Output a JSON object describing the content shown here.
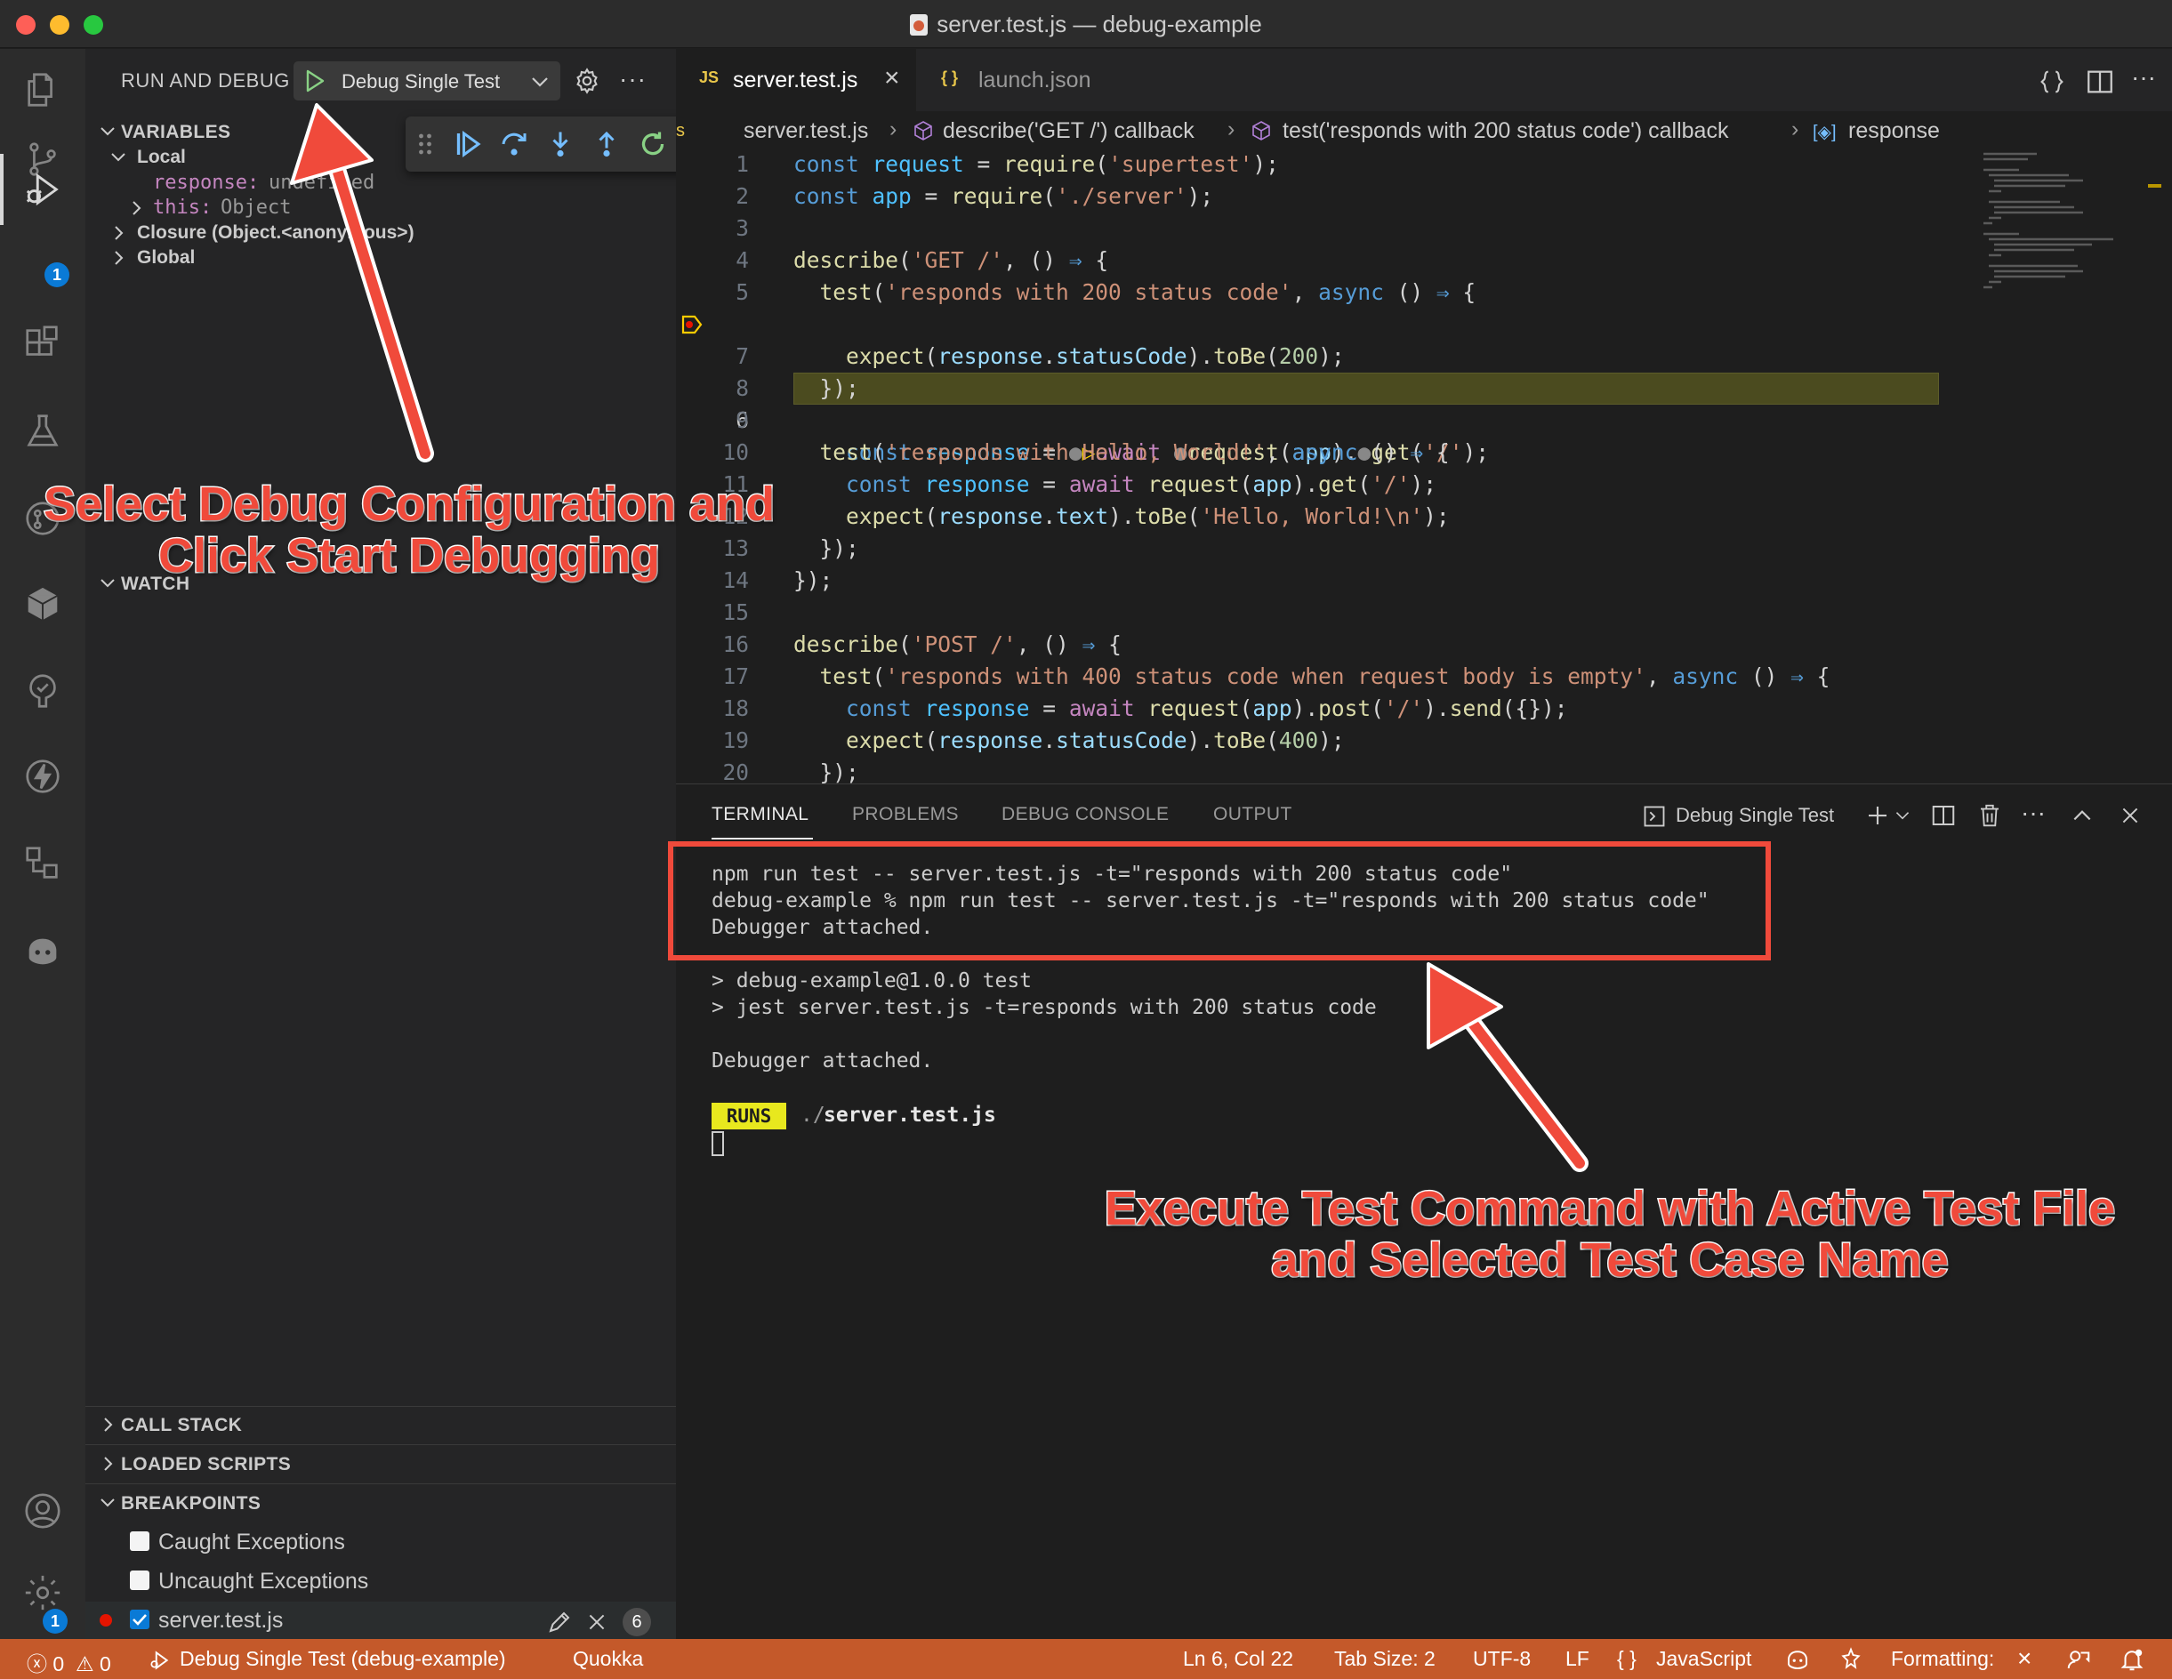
{
  "window": {
    "title": "server.test.js — debug-example"
  },
  "activity_bar": {
    "items": [
      "explorer-icon",
      "source-control-icon",
      "run-debug-icon",
      "extensions-icon",
      "testing-icon",
      "gitlens-icon",
      "package-icon",
      "tree-check-icon",
      "lightning-icon",
      "remote-explorer-icon",
      "copilot-icon"
    ],
    "run_debug_badge": "1",
    "settings_badge": "1"
  },
  "sidebar": {
    "title": "RUN AND DEBUG",
    "config": "Debug Single Test",
    "variables_header": "VARIABLES",
    "local_label": "Local",
    "variables": [
      {
        "name": "response:",
        "value": "undefined"
      },
      {
        "name": "this:",
        "value": "Object"
      }
    ],
    "closure_label": "Closure (Object.<anonymous>)",
    "global_label": "Global",
    "watch_header": "WATCH",
    "call_stack_header": "CALL STACK",
    "loaded_scripts_header": "LOADED SCRIPTS",
    "breakpoints_header": "BREAKPOINTS",
    "breakpoints": [
      {
        "label": "Caught Exceptions",
        "checked": false
      },
      {
        "label": "Uncaught Exceptions",
        "checked": false
      },
      {
        "label": "server.test.js",
        "checked": true,
        "line": "6"
      }
    ]
  },
  "editor": {
    "tabs": [
      {
        "icon_text": "JS",
        "label": "server.test.js",
        "close": "×"
      },
      {
        "icon_text": "{ }",
        "label": "launch.json"
      }
    ],
    "breadcrumb": [
      "server.test.js",
      "describe('GET /') callback",
      "test('responds with 200 status code') callback",
      "response"
    ],
    "line_numbers": [
      "1",
      "2",
      "3",
      "4",
      "5",
      "6",
      "7",
      "8",
      "9",
      "10",
      "11",
      "12",
      "13",
      "14",
      "15",
      "16",
      "17",
      "18",
      "19",
      "20"
    ],
    "current_line": "6"
  },
  "panel": {
    "tabs": [
      "TERMINAL",
      "PROBLEMS",
      "DEBUG CONSOLE",
      "OUTPUT"
    ],
    "terminal_name": "Debug Single Test",
    "terminal_lines": [
      "npm run test -- server.test.js -t=\"responds with 200 status code\"",
      "debug-example % npm run test -- server.test.js -t=\"responds with 200 status code\"",
      "Debugger attached.",
      "",
      "> debug-example@1.0.0 test",
      "> jest server.test.js -t=responds with 200 status code",
      "",
      "Debugger attached."
    ],
    "runs_badge": "RUNS",
    "runs_path_prefix": "./",
    "runs_file": "server.test.js"
  },
  "status_bar": {
    "errors": "0",
    "warnings": "0",
    "debug_target": "Debug Single Test (debug-example)",
    "quokka": "Quokka",
    "cursor": "Ln 6, Col 22",
    "tab_size": "Tab Size: 2",
    "encoding": "UTF-8",
    "eol": "LF",
    "language_braces": "{ }",
    "language": "JavaScript",
    "formatting": "Formatting:",
    "formatting_close": "×"
  },
  "annotations": {
    "top_left": [
      "Select Debug Configuration and",
      "Click Start Debugging"
    ],
    "bottom_right": [
      "Execute Test Command with Active Test File",
      "and Selected Test Case Name"
    ]
  },
  "colors": {
    "status_bar": "#c4592a",
    "annotation": "#f04a3b",
    "current_line_highlight": "#4b4b1f",
    "breakpoint": "#e51400"
  }
}
